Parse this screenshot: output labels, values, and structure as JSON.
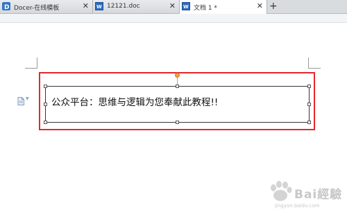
{
  "tabs": [
    {
      "label": "Docer-在线模板",
      "icon": "docer-icon"
    },
    {
      "label": "12121.doc",
      "icon": "word-doc-icon"
    },
    {
      "label": "文档 1 *",
      "icon": "word-doc-icon",
      "active": true
    }
  ],
  "close_glyph": "✕",
  "new_tab_glyph": "+",
  "textbox": {
    "text": "公众平台：思维与逻辑为您奉献此教程!!"
  },
  "watermark": {
    "text": "Bai經驗",
    "sub": "jingyan.baidu.com"
  },
  "colors": {
    "highlight": "#e5262b",
    "rotation_handle": "#f0a050"
  }
}
